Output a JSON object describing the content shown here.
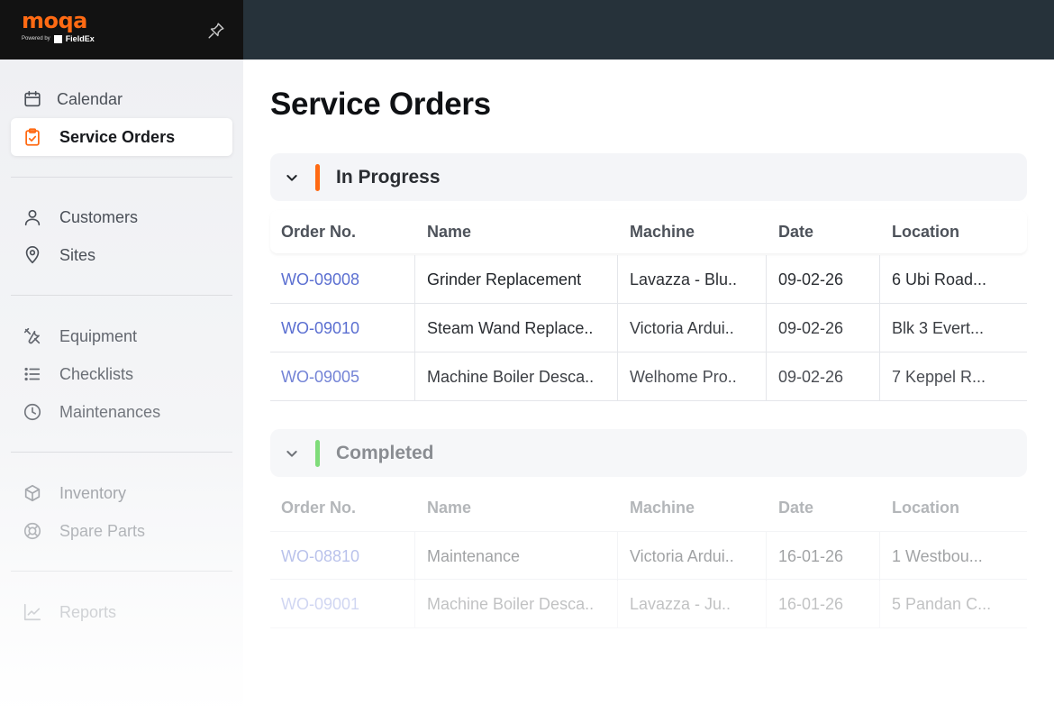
{
  "brand": {
    "logo_text": "moqa",
    "powered_by": "Powered by",
    "partner": "FieldEx"
  },
  "colors": {
    "accent": "#ff6a13",
    "link": "#5b6fd1",
    "in_progress": "#ff6a13",
    "completed": "#7fdc7a",
    "topbar": "#26323a"
  },
  "sidebar": {
    "items": [
      {
        "label": "Calendar",
        "icon": "calendar-icon"
      },
      {
        "label": "Service Orders",
        "icon": "clipboard-check-icon"
      },
      {
        "label": "Customers",
        "icon": "user-icon"
      },
      {
        "label": "Sites",
        "icon": "map-pin-icon"
      },
      {
        "label": "Equipment",
        "icon": "tools-icon"
      },
      {
        "label": "Checklists",
        "icon": "list-icon"
      },
      {
        "label": "Maintenances",
        "icon": "clock-icon"
      },
      {
        "label": "Inventory",
        "icon": "box-icon"
      },
      {
        "label": "Spare Parts",
        "icon": "lifebuoy-icon"
      },
      {
        "label": "Reports",
        "icon": "chart-line-icon"
      }
    ]
  },
  "page": {
    "title": "Service Orders"
  },
  "columns": [
    "Order No.",
    "Name",
    "Machine",
    "Date",
    "Location"
  ],
  "groups": [
    {
      "title": "In Progress",
      "rows": [
        {
          "order": "WO-09008",
          "name": "Grinder Replacement",
          "machine": "Lavazza - Blu..",
          "date": "09-02-26",
          "location": "6 Ubi Road..."
        },
        {
          "order": "WO-09010",
          "name": "Steam Wand Replace..",
          "machine": "Victoria Ardui..",
          "date": "09-02-26",
          "location": "Blk 3 Evert..."
        },
        {
          "order": "WO-09005",
          "name": "Machine Boiler Desca..",
          "machine": "Welhome Pro..",
          "date": "09-02-26",
          "location": "7 Keppel R..."
        }
      ]
    },
    {
      "title": "Completed",
      "rows": [
        {
          "order": "WO-08810",
          "name": "Maintenance",
          "machine": "Victoria Ardui..",
          "date": "16-01-26",
          "location": "1 Westbou..."
        },
        {
          "order": "WO-09001",
          "name": "Machine Boiler Desca..",
          "machine": "Lavazza - Ju..",
          "date": "16-01-26",
          "location": "5 Pandan C..."
        }
      ]
    }
  ]
}
